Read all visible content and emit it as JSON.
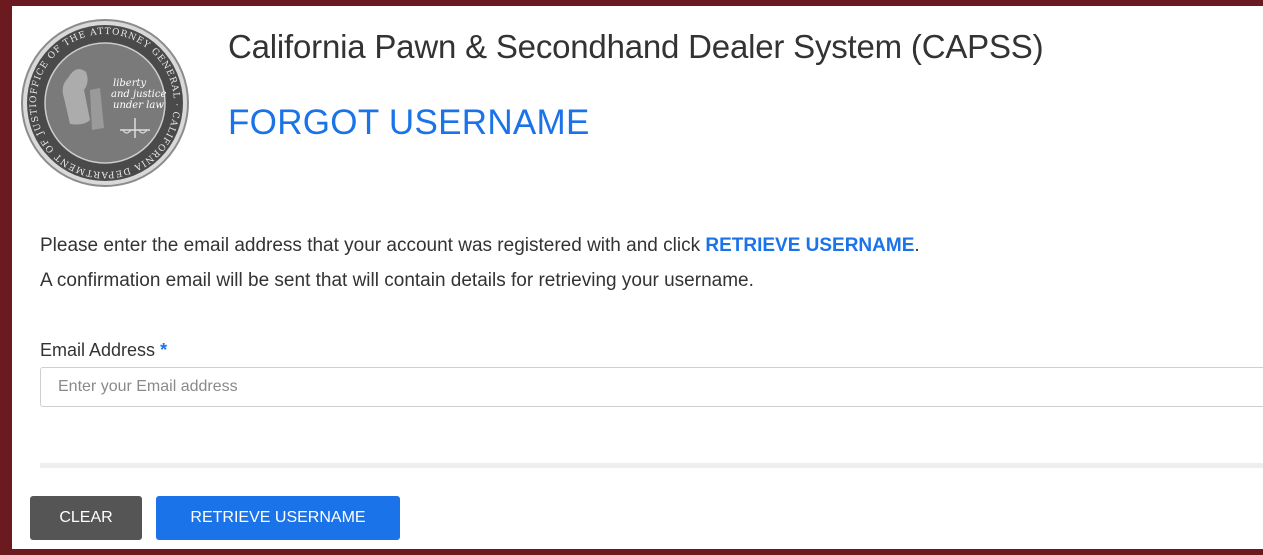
{
  "header": {
    "app_title": "California Pawn & Secondhand Dealer System (CAPSS)",
    "page_title": "FORGOT USERNAME"
  },
  "seal": {
    "outer_text": "OFFICE OF THE ATTORNEY GENERAL · CALIFORNIA DEPARTMENT OF JUSTICE",
    "motto": [
      "liberty",
      "and justice",
      "under law"
    ]
  },
  "instructions": {
    "line1_prefix": "Please enter the email address that your account was registered with and click ",
    "line1_action": "RETRIEVE USERNAME",
    "line1_suffix": ".",
    "line2": "A confirmation email will be sent that will contain details for retrieving your username."
  },
  "form": {
    "email_label": "Email Address",
    "required_marker": "*",
    "email_placeholder": "Enter your Email address",
    "email_value": ""
  },
  "buttons": {
    "clear_label": "CLEAR",
    "retrieve_label": "RETRIEVE USERNAME"
  },
  "colors": {
    "frame": "#6b1a1f",
    "accent": "#1a73e8",
    "clear_button": "#555555"
  }
}
